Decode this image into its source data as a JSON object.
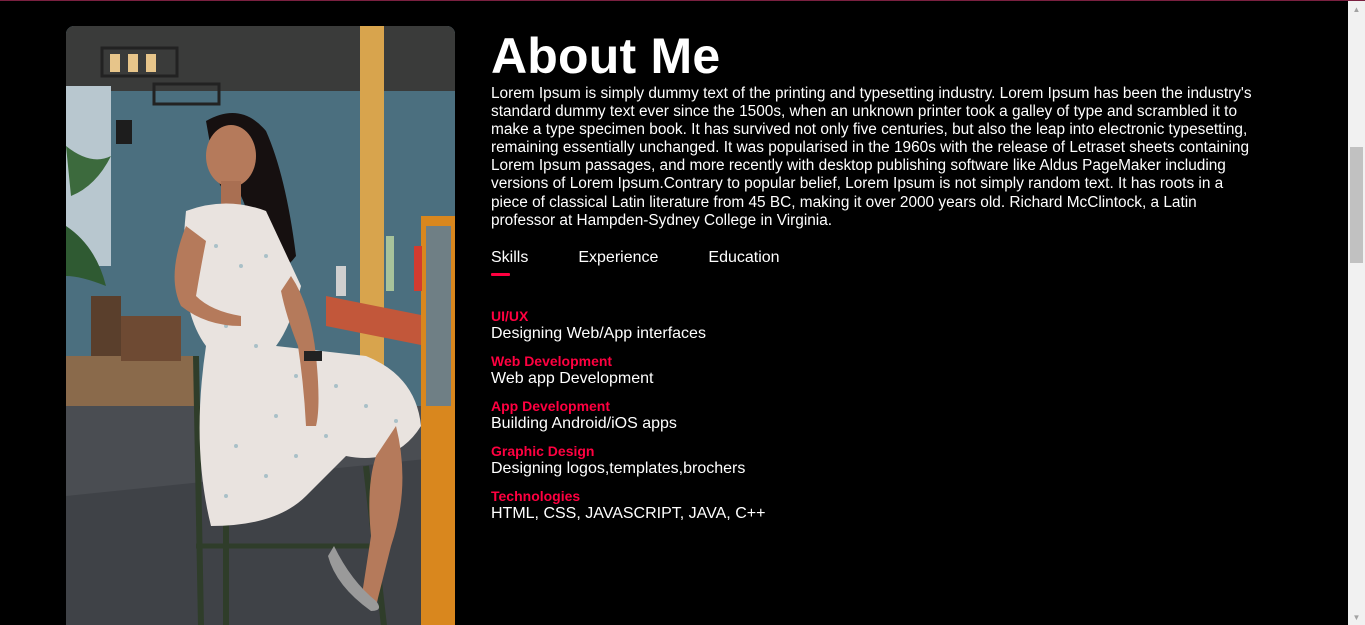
{
  "about": {
    "title": "About Me",
    "bio": "Lorem Ipsum is simply dummy text of the printing and typesetting industry. Lorem Ipsum has been the industry's standard dummy text ever since the 1500s, when an unknown printer took a galley of type and scrambled it to make a type specimen book. It has survived not only five centuries, but also the leap into electronic typesetting, remaining essentially unchanged. It was popularised in the 1960s with the release of Letraset sheets containing Lorem Ipsum passages, and more recently with desktop publishing software like Aldus PageMaker including versions of Lorem Ipsum.Contrary to popular belief, Lorem Ipsum is not simply random text. It has roots in a piece of classical Latin literature from 45 BC, making it over 2000 years old. Richard McClintock, a Latin professor at Hampden-Sydney College in Virginia."
  },
  "tabs": [
    {
      "label": "Skills",
      "active": true
    },
    {
      "label": "Experience",
      "active": false
    },
    {
      "label": "Education",
      "active": false
    }
  ],
  "skills": [
    {
      "name": "UI/UX",
      "description": "Designing Web/App interfaces"
    },
    {
      "name": "Web Development",
      "description": "Web app Development"
    },
    {
      "name": "App Development",
      "description": "Building Android/iOS apps"
    },
    {
      "name": "Graphic Design",
      "description": "Designing logos,templates,brochers"
    },
    {
      "name": "Technologies",
      "description": "HTML, CSS, JAVASCRIPT, JAVA, C++"
    }
  ],
  "colors": {
    "accent": "#ff0040",
    "background": "#000000",
    "text": "#ffffff"
  },
  "icons": {
    "scroll_up": "triangle-up-icon",
    "scroll_down": "triangle-down-icon"
  }
}
